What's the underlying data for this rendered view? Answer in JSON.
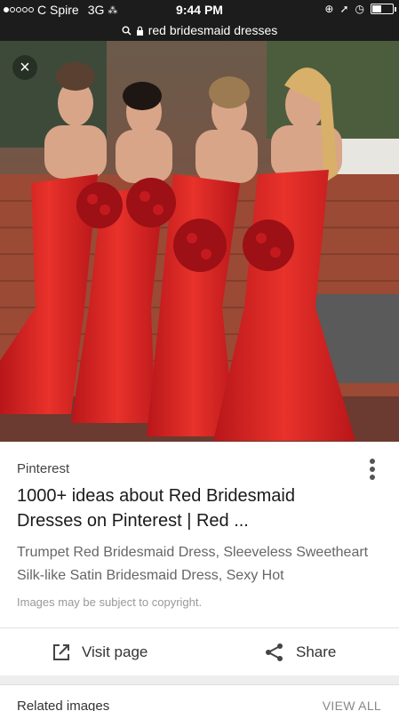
{
  "status_bar": {
    "carrier": "C Spire",
    "network": "3G",
    "time": "9:44 PM",
    "battery_level": 0.45
  },
  "url_bar": {
    "query": "red bridesmaid dresses"
  },
  "image": {
    "description_icon": "photo-placeholder",
    "close_label": "×"
  },
  "result": {
    "source": "Pinterest",
    "title": "1000+ ideas about Red Bridesmaid Dresses on Pinterest | Red ...",
    "description": "Trumpet Red Bridesmaid Dress, Sleeveless Sweetheart Silk-like Satin Bridesmaid Dress, Sexy Hot",
    "copyright": "Images may be subject to copyright."
  },
  "actions": {
    "visit_label": "Visit page",
    "share_label": "Share"
  },
  "related": {
    "label": "Related images",
    "view_all": "VIEW ALL"
  },
  "colors": {
    "dress_red": "#e0241f",
    "status_bg": "#1c1c1c"
  }
}
